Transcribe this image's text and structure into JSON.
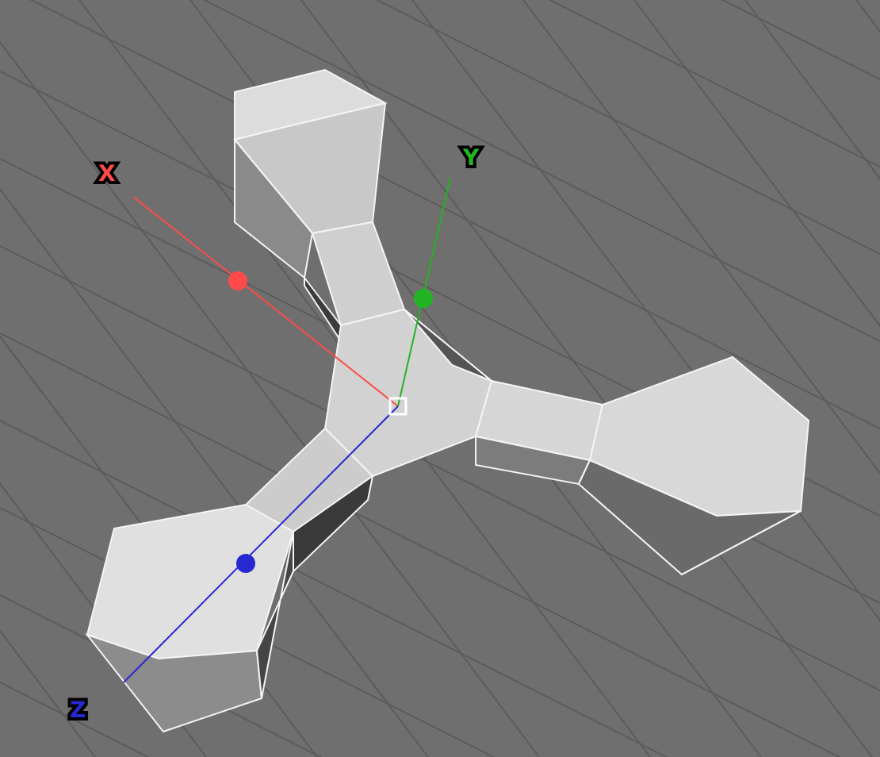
{
  "viewport": {
    "axes": [
      {
        "label": "X",
        "color": "#ff4a4a"
      },
      {
        "label": "Y",
        "color": "#22b422"
      },
      {
        "label": "Z",
        "color": "#2828d2"
      }
    ]
  }
}
